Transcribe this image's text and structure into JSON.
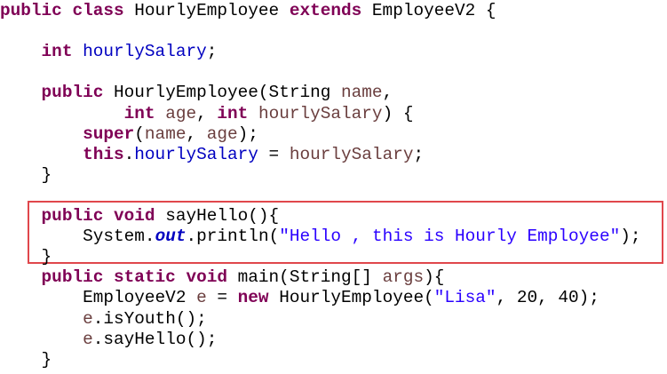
{
  "editor": {
    "lines": [
      {
        "indent": "",
        "tokens": [
          {
            "t": "public class ",
            "c": "kw"
          },
          {
            "t": "HourlyEmployee ",
            "c": ""
          },
          {
            "t": "extends ",
            "c": "kw"
          },
          {
            "t": "EmployeeV2 {",
            "c": ""
          }
        ]
      },
      {
        "indent": "",
        "tokens": []
      },
      {
        "indent": "    ",
        "tokens": [
          {
            "t": "int ",
            "c": "kw"
          },
          {
            "t": "hourlySalary",
            "c": "field"
          },
          {
            "t": ";",
            "c": ""
          }
        ]
      },
      {
        "indent": "",
        "tokens": []
      },
      {
        "indent": "    ",
        "tokens": [
          {
            "t": "public ",
            "c": "kw"
          },
          {
            "t": "HourlyEmployee(String ",
            "c": ""
          },
          {
            "t": "name",
            "c": "param"
          },
          {
            "t": ",",
            "c": ""
          }
        ]
      },
      {
        "indent": "            ",
        "tokens": [
          {
            "t": "int ",
            "c": "kw"
          },
          {
            "t": "age",
            "c": "param"
          },
          {
            "t": ", ",
            "c": ""
          },
          {
            "t": "int ",
            "c": "kw"
          },
          {
            "t": "hourlySalary",
            "c": "param"
          },
          {
            "t": ") {",
            "c": ""
          }
        ]
      },
      {
        "indent": "        ",
        "tokens": [
          {
            "t": "super",
            "c": "kw"
          },
          {
            "t": "(",
            "c": ""
          },
          {
            "t": "name",
            "c": "param"
          },
          {
            "t": ", ",
            "c": ""
          },
          {
            "t": "age",
            "c": "param"
          },
          {
            "t": ");",
            "c": ""
          }
        ]
      },
      {
        "indent": "        ",
        "tokens": [
          {
            "t": "this",
            "c": "kw"
          },
          {
            "t": ".",
            "c": ""
          },
          {
            "t": "hourlySalary",
            "c": "field"
          },
          {
            "t": " = ",
            "c": ""
          },
          {
            "t": "hourlySalary",
            "c": "param"
          },
          {
            "t": ";",
            "c": ""
          }
        ]
      },
      {
        "indent": "    ",
        "tokens": [
          {
            "t": "}",
            "c": ""
          }
        ]
      },
      {
        "indent": "",
        "tokens": []
      },
      {
        "indent": "    ",
        "tokens": [
          {
            "t": "public void ",
            "c": "kw"
          },
          {
            "t": "sayHello(){",
            "c": ""
          }
        ]
      },
      {
        "indent": "        ",
        "tokens": [
          {
            "t": "System.",
            "c": ""
          },
          {
            "t": "out",
            "c": "static-field"
          },
          {
            "t": ".println(",
            "c": ""
          },
          {
            "t": "\"Hello , this is Hourly Employee\"",
            "c": "str"
          },
          {
            "t": ");",
            "c": ""
          }
        ]
      },
      {
        "indent": "    ",
        "tokens": [
          {
            "t": "}",
            "c": ""
          }
        ]
      },
      {
        "indent": "    ",
        "tokens": [
          {
            "t": "public static void ",
            "c": "kw"
          },
          {
            "t": "main(String[] ",
            "c": ""
          },
          {
            "t": "args",
            "c": "param"
          },
          {
            "t": "){",
            "c": ""
          }
        ]
      },
      {
        "indent": "        ",
        "tokens": [
          {
            "t": "EmployeeV2 ",
            "c": ""
          },
          {
            "t": "e",
            "c": "param"
          },
          {
            "t": " = ",
            "c": ""
          },
          {
            "t": "new ",
            "c": "kw"
          },
          {
            "t": "HourlyEmployee(",
            "c": ""
          },
          {
            "t": "\"Lisa\"",
            "c": "str"
          },
          {
            "t": ", 20, 40);",
            "c": ""
          }
        ]
      },
      {
        "indent": "        ",
        "tokens": [
          {
            "t": "e",
            "c": "param"
          },
          {
            "t": ".isYouth();",
            "c": ""
          }
        ]
      },
      {
        "indent": "        ",
        "tokens": [
          {
            "t": "e",
            "c": "param"
          },
          {
            "t": ".sayHello();",
            "c": ""
          }
        ]
      },
      {
        "indent": "    ",
        "tokens": [
          {
            "t": "}",
            "c": ""
          }
        ]
      }
    ],
    "highlight_color": "#e0474c"
  }
}
